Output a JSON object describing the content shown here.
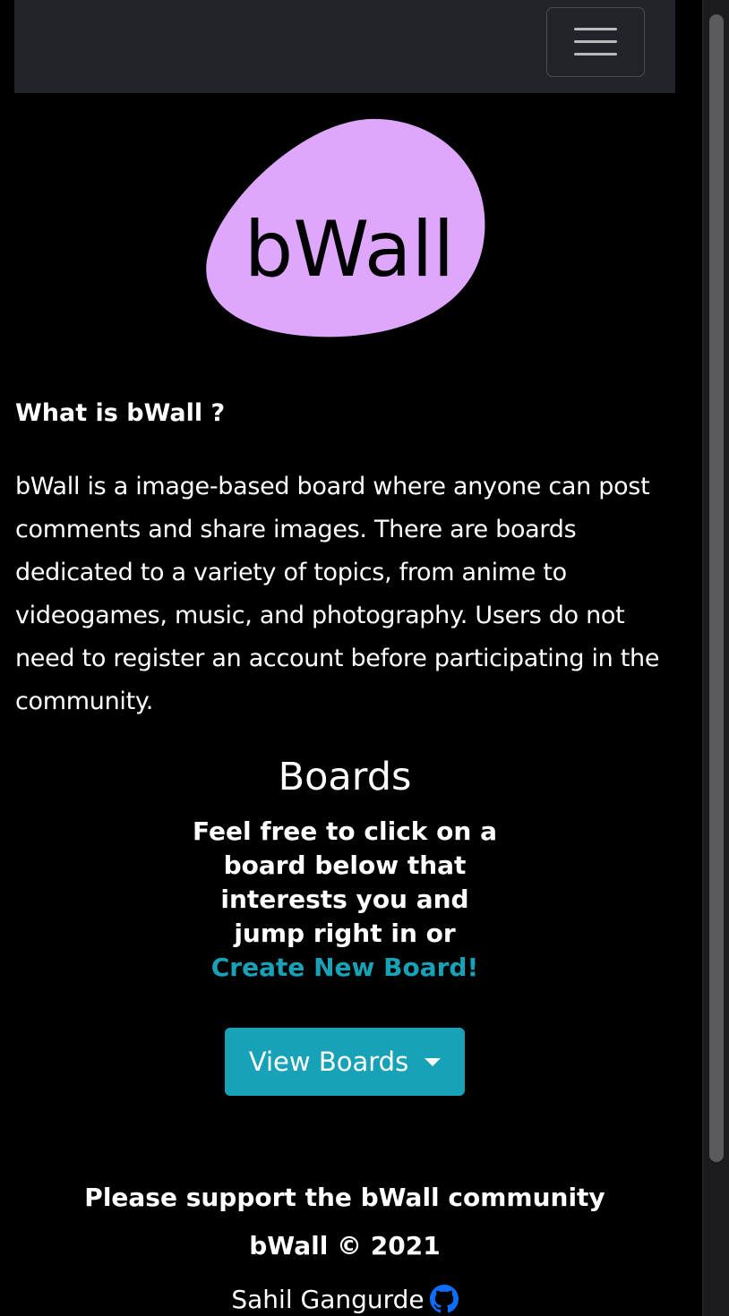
{
  "navbar": {
    "toggler_icon": "hamburger-menu-icon"
  },
  "logo": {
    "text": "bWall",
    "blob_color": "#dfa7fb",
    "text_color": "#000000"
  },
  "about": {
    "title": "What is bWall ?",
    "description": "bWall is a image-based board where anyone can post comments and share images. There are boards dedicated to a variety of topics, from anime to videogames, music, and photography. Users do not need to register an account before participating in the community."
  },
  "boards": {
    "title": "Boards",
    "subtitle_prefix": "Feel free to click on a board below that interests you and jump right in or ",
    "create_link_label": "Create New Board!",
    "view_button_label": "View Boards",
    "view_button_icon": "caret-down-icon"
  },
  "footer": {
    "support": "Please support the bWall community",
    "copyright": "bWall © 2021",
    "author": "Sahil Gangurde",
    "author_icon": "github-icon"
  },
  "colors": {
    "background": "#000000",
    "navbar": "#212529",
    "accent": "#17a2b8",
    "logo_blob": "#dfa7fb",
    "github_icon": "#0d6efd"
  }
}
